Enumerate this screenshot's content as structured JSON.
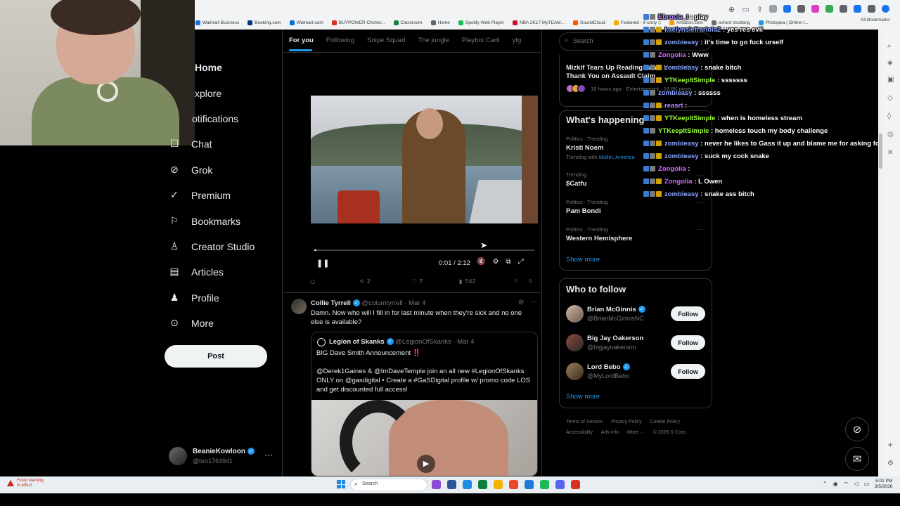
{
  "browser": {
    "bookmarks": [
      "Walmart Business",
      "Booking.com",
      "Walmart.com",
      "BUYPOWER Chimer...",
      "Classroom",
      "Home",
      "Spotify Web Player",
      "NBA 2K17 MyTEAM...",
      "SoundCloud",
      "Featured - iFunny :)",
      "Amazon.com",
      "oxford mustang",
      "Photopea | Online I..."
    ],
    "all_bookmarks": "All Bookmarks",
    "bookmark_colors": [
      "#1a73e8",
      "#003580",
      "#0071dc",
      "#d93025",
      "#188038",
      "#5f6368",
      "#1db954",
      "#c8102e",
      "#ff5500",
      "#f9ab00",
      "#ff9900",
      "#6c6c6c",
      "#1a9cd8"
    ]
  },
  "nav": {
    "items": [
      {
        "label": "Home",
        "icon": "home-icon"
      },
      {
        "label": "Explore",
        "icon": "search-icon"
      },
      {
        "label": "Notifications",
        "icon": "bell-icon"
      },
      {
        "label": "Chat",
        "icon": "chat-icon"
      },
      {
        "label": "Grok",
        "icon": "grok-icon"
      },
      {
        "label": "Premium",
        "icon": "premium-icon"
      },
      {
        "label": "Bookmarks",
        "icon": "bookmark-icon"
      },
      {
        "label": "Creator Studio",
        "icon": "creator-studio-icon"
      },
      {
        "label": "Articles",
        "icon": "articles-icon"
      },
      {
        "label": "Profile",
        "icon": "profile-icon"
      },
      {
        "label": "More",
        "icon": "more-icon"
      }
    ],
    "visible_labels": {
      "home": "Home",
      "explore": "xplore",
      "notifications": "otifications"
    },
    "post_button": "Post",
    "account": {
      "name": "BeanieKowloon",
      "handle": "@bro1763941"
    }
  },
  "tabs": [
    "For you",
    "Following",
    "Snipe Squad",
    "The jungle",
    "Playboi Carti",
    "ytg"
  ],
  "video": {
    "time": "0:01 / 2:12",
    "progress_fraction": 0.005
  },
  "post1_actions": {
    "replies": "",
    "reposts": "2",
    "likes": "7",
    "views": "542"
  },
  "post2": {
    "name": "Collie Tyrrell",
    "handle": "@columtyrrell",
    "date": "· Mar 4",
    "text": "Damn. Now who will I fill in for last minute when they're sick and no one else is available?",
    "quote": {
      "name": "Legion of Skanks",
      "handle": "@LegionOfSkanks",
      "date": "· Mar 4",
      "line1": "BIG Dave Smith Announcement ‼️",
      "line2": "@Derek1Gaines & @ImDaveTemple join an all new #LegionOfSkanks ONLY on @gasdigital  • Create a #GaSDigital profile w/ promo code LOS and get discounted full access!"
    }
  },
  "sidebar": {
    "search_placeholder": "Search",
    "news": {
      "title": "Mizkif Tears Up Reading Fan's Heartfelt Thank You on Assault Claim",
      "meta": "19 hours ago · Entertainment · 16.6K posts"
    },
    "happening_title": "What's happening",
    "trends": [
      {
        "meta": "Politics · Trending",
        "name": "Kristi Noem",
        "sub": "Trending with",
        "links": "Mullin, America"
      },
      {
        "meta": "Trending",
        "name": "$Catfu",
        "sub": "",
        "links": ""
      },
      {
        "meta": "Politics · Trending",
        "name": "Pam Bondi",
        "sub": "",
        "links": ""
      },
      {
        "meta": "Politics · Trending",
        "name": "Western Hemisphere",
        "sub": "",
        "links": ""
      }
    ],
    "show_more": "Show more",
    "who_to_follow": "Who to follow",
    "follow": [
      {
        "name": "Brian McGinnis",
        "handle": "@BrianMcGinnisNC",
        "button": "Follow"
      },
      {
        "name": "Big Jay Oakerson",
        "handle": "@bigjayoakerson",
        "button": "Follow"
      },
      {
        "name": "Lord Bebo",
        "handle": "@MyLordBebo",
        "button": "Follow"
      }
    ],
    "footer": [
      "Terms of Service",
      "Privacy Policy",
      "Cookie Policy",
      "Accessibility",
      "Ads info",
      "More ···",
      "© 2026 X Corp."
    ]
  },
  "chat": [
    {
      "user": "Ebrocia_t",
      "msg": "play",
      "color": "#b98bff"
    },
    {
      "user": "kaelynslefrariola2",
      "msg": "yes res evil",
      "color": "#8aa4ff"
    },
    {
      "user": "zombieasy",
      "msg": "it's time to go fuck urself",
      "color": "#8aa4ff"
    },
    {
      "user": "Zongolia",
      "msg": "Www",
      "color": "#cf6bff"
    },
    {
      "user": "zombieasy",
      "msg": "snake bitch",
      "color": "#8aa4ff"
    },
    {
      "user": "YTKeepItSimple",
      "msg": "sssssss",
      "color": "#9eff3a"
    },
    {
      "user": "zombieasy",
      "msg": "ssssss",
      "color": "#8aa4ff"
    },
    {
      "user": "reasrt",
      "msg": "",
      "color": "#b98bff"
    },
    {
      "user": "YTKeepItSimple",
      "msg": "when is homeless stream",
      "color": "#9eff3a"
    },
    {
      "user": "YTKeepItSimple",
      "msg": "homeless touch my body challenge",
      "color": "#9eff3a"
    },
    {
      "user": "zombieasy",
      "msg": "never he likes to Gass it up and blame me for asking for it",
      "color": "#8aa4ff"
    },
    {
      "user": "zombieasy",
      "msg": "suck my cock snake",
      "color": "#8aa4ff"
    },
    {
      "user": "Zongolia",
      "msg": "",
      "color": "#cf6bff"
    },
    {
      "user": "Zongolia",
      "msg": "L Owen",
      "color": "#cf6bff"
    },
    {
      "user": "zombieasy",
      "msg": "snake ass bitch",
      "color": "#8aa4ff"
    }
  ],
  "taskbar": {
    "weather": [
      "Flood warning",
      "In effect"
    ],
    "search": "Search",
    "clock": [
      "5:01 PM",
      "3/5/2026"
    ],
    "app_colors": [
      "#8a4bd6",
      "#2b579a",
      "#1f8be3",
      "#0a7e3a",
      "#f2b400",
      "#e94a2d",
      "#1e7bd6",
      "#1db954",
      "#5865f2",
      "#d93025"
    ]
  }
}
